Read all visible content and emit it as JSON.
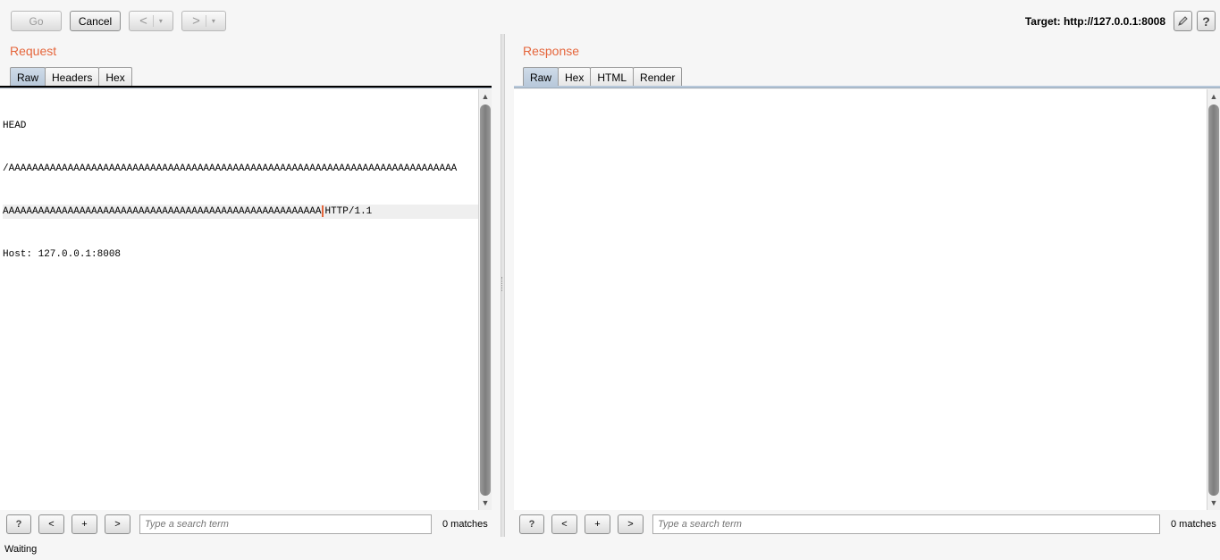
{
  "toolbar": {
    "go_label": "Go",
    "cancel_label": "Cancel",
    "back_arrow": "<",
    "forward_arrow": ">",
    "dropdown_glyph": "▾",
    "target_text": "Target: http://127.0.0.1:8008",
    "edit_icon": "pencil-icon",
    "help_glyph": "?"
  },
  "request": {
    "title": "Request",
    "tabs": [
      {
        "label": "Raw",
        "active": true
      },
      {
        "label": "Headers",
        "active": false
      },
      {
        "label": "Hex",
        "active": false
      }
    ],
    "lines": [
      "HEAD",
      "/AAAAAAAAAAAAAAAAAAAAAAAAAAAAAAAAAAAAAAAAAAAAAAAAAAAAAAAAAAAAAAAAAAAAAAAAAAAA",
      "AAAAAAAAAAAAAAAAAAAAAAAAAAAAAAAAAAAAAAAAAAAAAAAAAAAAAA",
      "HTTP/1.1",
      "Host: 127.0.0.1:8008"
    ],
    "search": {
      "help": "?",
      "prev": "<",
      "add": "+",
      "next": ">",
      "placeholder": "Type a search term",
      "matches": "0 matches"
    }
  },
  "response": {
    "title": "Response",
    "tabs": [
      {
        "label": "Raw",
        "active": true
      },
      {
        "label": "Hex",
        "active": false
      },
      {
        "label": "HTML",
        "active": false
      },
      {
        "label": "Render",
        "active": false
      }
    ],
    "search": {
      "help": "?",
      "prev": "<",
      "add": "+",
      "next": ">",
      "placeholder": "Type a search term",
      "matches": "0 matches"
    }
  },
  "status": "Waiting",
  "colors": {
    "accent": "#e5663c",
    "tab_active": "#c3d2e2",
    "divider": "#000000"
  }
}
